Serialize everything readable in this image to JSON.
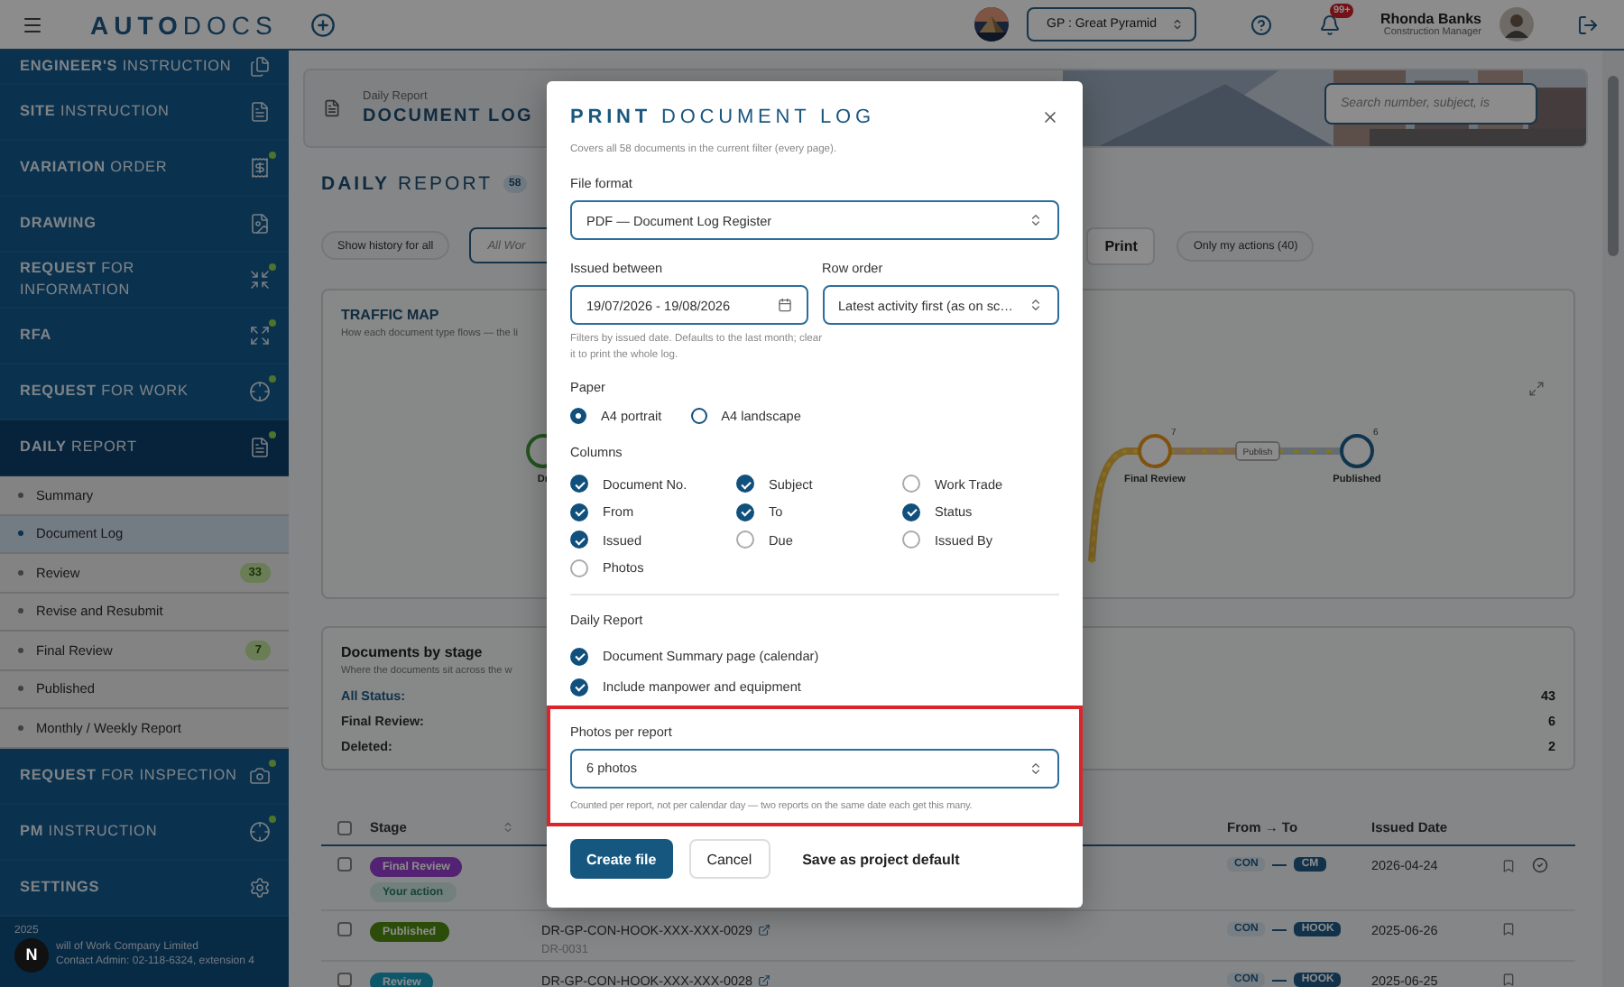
{
  "top_bar": {
    "logo_bold": "AUTO",
    "logo_light": "DOCS",
    "project": "GP : Great Pyramid",
    "notification_count": "99+",
    "user_name": "Rhonda Banks",
    "user_role": "Construction Manager"
  },
  "sidebar": {
    "items": [
      {
        "bold": "ENGINEER'S",
        "rest": "INSTRUCTION",
        "alert": false,
        "selected": false
      },
      {
        "bold": "SITE",
        "rest": "INSTRUCTION",
        "alert": false,
        "selected": false
      },
      {
        "bold": "VARIATION",
        "rest": "ORDER",
        "alert": true,
        "selected": false
      },
      {
        "bold": "DRAWING",
        "alert": false,
        "selected": false
      },
      {
        "bold": "REQUEST",
        "rest": "FOR INFORMATION",
        "alert": true,
        "selected": false
      },
      {
        "bold": "RFA",
        "alert": true,
        "selected": false
      },
      {
        "bold": "REQUEST",
        "rest": "FOR WORK",
        "alert": true,
        "selected": false
      },
      {
        "bold": "DAILY",
        "rest": "REPORT",
        "alert": true,
        "selected": true,
        "children": [
          {
            "label": "Summary",
            "selected": false
          },
          {
            "label": "Document Log",
            "selected": true
          },
          {
            "label": "Review",
            "selected": false,
            "count": "33"
          },
          {
            "label": "Revise and Resubmit",
            "selected": false
          },
          {
            "label": "Final Review",
            "selected": false,
            "count": "7"
          },
          {
            "label": "Published",
            "selected": false
          },
          {
            "label": "Monthly / Weekly Report",
            "selected": false
          }
        ]
      },
      {
        "bold": "REQUEST",
        "rest": "FOR INSPECTION",
        "alert": true,
        "selected": false
      },
      {
        "bold": "PM",
        "rest": "INSTRUCTION",
        "alert": true,
        "selected": false
      },
      {
        "bold": "SETTINGS",
        "alert": false,
        "selected": false
      }
    ],
    "footer": {
      "year": "2025",
      "company": "will of Work Company Limited",
      "contact": "Contact Admin: 02-118-6324, extension 4",
      "dev_badge": "N"
    }
  },
  "header": {
    "breadcrumb": "Daily Report",
    "title": "DOCUMENT LOG",
    "search_placeholder": "Search number, subject, is"
  },
  "page_title": {
    "bold": "DAILY",
    "rest": "REPORT",
    "count": "58"
  },
  "filters": {
    "history_button": "Show history for all",
    "work_select": "All Wor",
    "print_button": "Print",
    "my_actions": "Only my actions (40)"
  },
  "traffic_map": {
    "title": "TRAFFIC MAP",
    "subtitle": "How each document type flows — the li",
    "edge_label": "Publish",
    "nodes": [
      {
        "label": "Dr",
        "kind": "start"
      },
      {
        "label": "Final Review",
        "count": "7",
        "kind": "review"
      },
      {
        "label": "Published",
        "count": "6",
        "kind": "end"
      }
    ]
  },
  "stage_summary": {
    "title": "Documents by stage",
    "subtitle": "Where the documents sit across the w",
    "rows": [
      {
        "label": "All Status:",
        "value": "43",
        "kind": "link"
      },
      {
        "label": "Final Review:",
        "value": "6",
        "kind": "plain"
      },
      {
        "label": "Deleted:",
        "value": "2",
        "kind": "plain"
      }
    ]
  },
  "table": {
    "select_all_checked": false,
    "columns": {
      "stage": "Stage",
      "route": "From → To",
      "issued": "Issued Date"
    },
    "rows": [
      {
        "checked": false,
        "stages": [
          {
            "label": "Final Review",
            "kind": "final_review"
          },
          {
            "label": "Your action",
            "kind": "your_action"
          }
        ],
        "from": "CON",
        "to": "CM",
        "issued": "2026-04-24",
        "acknowledged": true
      },
      {
        "checked": false,
        "stages": [
          {
            "label": "Published",
            "kind": "published"
          }
        ],
        "document_no": "DR-GP-CON-HOOK-XXX-XXX-0029",
        "reference": "DR-0031",
        "from": "CON",
        "to": "HOOK",
        "issued": "2025-06-26",
        "acknowledged": false
      },
      {
        "checked": false,
        "stages": [
          {
            "label": "Review",
            "kind": "review"
          }
        ],
        "document_no": "DR-GP-CON-HOOK-XXX-XXX-0028",
        "from": "CON",
        "to": "HOOK",
        "issued": "2025-06-25",
        "acknowledged": false
      }
    ]
  },
  "print_dialog": {
    "title_bold": "PRINT",
    "title_rest": "DOCUMENT LOG",
    "intro": "Covers all 58 documents in the current filter (every page).",
    "file_format": {
      "label": "File format",
      "value": "PDF — Document Log Register"
    },
    "issued_between": {
      "label": "Issued between",
      "value": "19/07/2026 - 19/08/2026",
      "hint": "Filters by issued date. Defaults to the last month; clear it to print the whole log."
    },
    "row_order": {
      "label": "Row order",
      "value": "Latest activity first (as on sc…"
    },
    "paper": {
      "label": "Paper",
      "options": [
        {
          "label": "A4 portrait",
          "selected": true
        },
        {
          "label": "A4 landscape",
          "selected": false
        }
      ]
    },
    "columns": {
      "label": "Columns",
      "options": [
        {
          "label": "Document No.",
          "checked": true
        },
        {
          "label": "Subject",
          "checked": true
        },
        {
          "label": "Work Trade",
          "checked": false
        },
        {
          "label": "From",
          "checked": true
        },
        {
          "label": "To",
          "checked": true
        },
        {
          "label": "Status",
          "checked": true
        },
        {
          "label": "Issued",
          "checked": true
        },
        {
          "label": "Due",
          "checked": false
        },
        {
          "label": "Issued By",
          "checked": false
        },
        {
          "label": "Photos",
          "checked": false
        }
      ]
    },
    "daily_report": {
      "label": "Daily Report",
      "options": [
        {
          "label": "Document Summary page (calendar)",
          "checked": true
        },
        {
          "label": "Include manpower and equipment",
          "checked": true
        }
      ]
    },
    "photos_per_report": {
      "label": "Photos per report",
      "value": "6 photos",
      "hint": "Counted per report, not per calendar day — two reports on the same date each get this many.",
      "highlighted": true
    },
    "buttons": {
      "create": "Create file",
      "cancel": "Cancel",
      "save_default": "Save as project default"
    }
  }
}
